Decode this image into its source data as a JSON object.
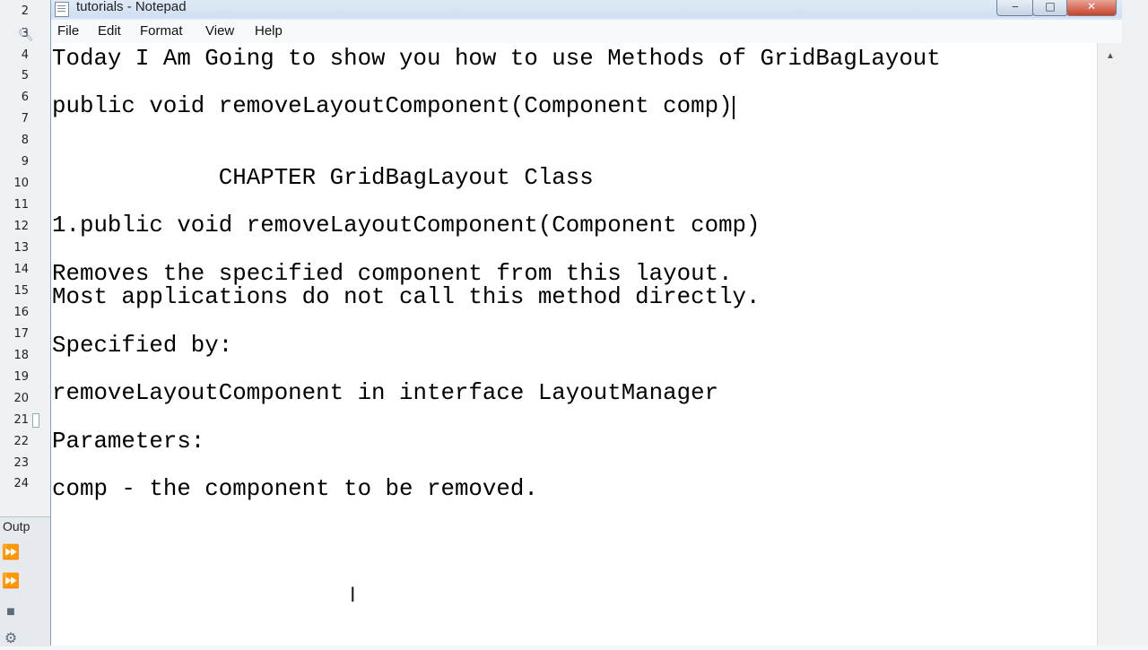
{
  "window": {
    "title": "tutorials - Notepad"
  },
  "menu": [
    "File",
    "Edit",
    "Format",
    "View",
    "Help"
  ],
  "ide": {
    "line_numbers": [
      "2",
      "3",
      "4",
      "5",
      "6",
      "7",
      "8",
      "9",
      "10",
      "11",
      "12",
      "13",
      "14",
      "15",
      "16",
      "17",
      "18",
      "19",
      "20",
      "21",
      "22",
      "23",
      "24"
    ],
    "output_title": "Outp"
  },
  "document": {
    "lines": [
      "Today I Am Going to show you how to use Methods of GridBagLayout",
      "public void removeLayoutComponent(Component comp)",
      "            CHAPTER GridBagLayout Class",
      "1.public void removeLayoutComponent(Component comp)",
      "Removes the specified component from this layout.",
      "Most applications do not call this method directly.",
      "Specified by:",
      "removeLayoutComponent in interface LayoutManager",
      "Parameters:",
      "comp - the component to be removed."
    ]
  },
  "icons": {
    "minimize": "minimize-icon",
    "maximize": "maximize-icon",
    "close": "close-icon",
    "notepad": "notepad-icon",
    "ibeam": "ibeam-cursor-icon",
    "search": "search-icon",
    "run": "run-icon",
    "stop": "stop-icon",
    "settings": "settings-icon"
  }
}
